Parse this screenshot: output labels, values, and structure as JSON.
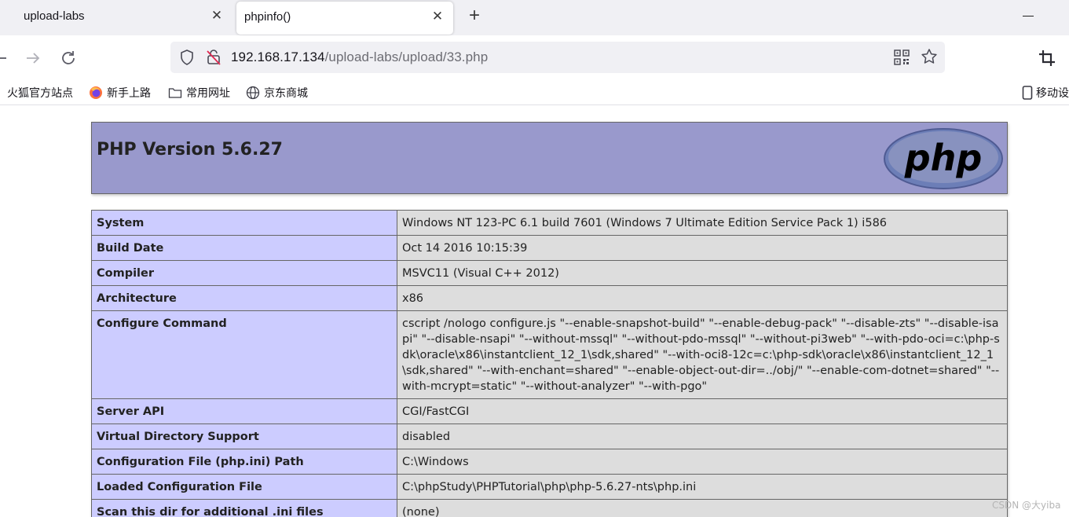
{
  "browser": {
    "tabs": [
      {
        "title": "upload-labs",
        "close": "✕"
      },
      {
        "title": "phpinfo()",
        "close": "✕"
      }
    ],
    "new_tab": "+",
    "url": {
      "host": "192.168.17.134",
      "path": "/upload-labs/upload/33.php"
    },
    "bookmarks": [
      {
        "label": "火狐官方站点"
      },
      {
        "label": "新手上路"
      },
      {
        "label": "常用网址"
      },
      {
        "label": "京东商城"
      },
      {
        "label": "移动设"
      }
    ]
  },
  "page": {
    "title": "PHP Version 5.6.27",
    "logo_text": "php",
    "rows": [
      {
        "key": "System",
        "value": "Windows NT 123-PC 6.1 build 7601 (Windows 7 Ultimate Edition Service Pack 1) i586"
      },
      {
        "key": "Build Date",
        "value": "Oct 14 2016 10:15:39"
      },
      {
        "key": "Compiler",
        "value": "MSVC11 (Visual C++ 2012)"
      },
      {
        "key": "Architecture",
        "value": "x86"
      },
      {
        "key": "Configure Command",
        "value": "cscript /nologo configure.js \"--enable-snapshot-build\" \"--enable-debug-pack\" \"--disable-zts\" \"--disable-isapi\" \"--disable-nsapi\" \"--without-mssql\" \"--without-pdo-mssql\" \"--without-pi3web\" \"--with-pdo-oci=c:\\php-sdk\\oracle\\x86\\instantclient_12_1\\sdk,shared\" \"--with-oci8-12c=c:\\php-sdk\\oracle\\x86\\instantclient_12_1\\sdk,shared\" \"--with-enchant=shared\" \"--enable-object-out-dir=../obj/\" \"--enable-com-dotnet=shared\" \"--with-mcrypt=static\" \"--without-analyzer\" \"--with-pgo\""
      },
      {
        "key": "Server API",
        "value": "CGI/FastCGI"
      },
      {
        "key": "Virtual Directory Support",
        "value": "disabled"
      },
      {
        "key": "Configuration File (php.ini) Path",
        "value": "C:\\Windows"
      },
      {
        "key": "Loaded Configuration File",
        "value": "C:\\phpStudy\\PHPTutorial\\php\\php-5.6.27-nts\\php.ini"
      },
      {
        "key": "Scan this dir for additional .ini files",
        "value": "(none)"
      }
    ]
  },
  "watermark": "CSDN @大yiba",
  "colors": {
    "header_bg": "#9999cc",
    "key_cell_bg": "#ccccff",
    "value_cell_bg": "#dddddd",
    "tabstrip_bg": "#f0f0f4"
  }
}
